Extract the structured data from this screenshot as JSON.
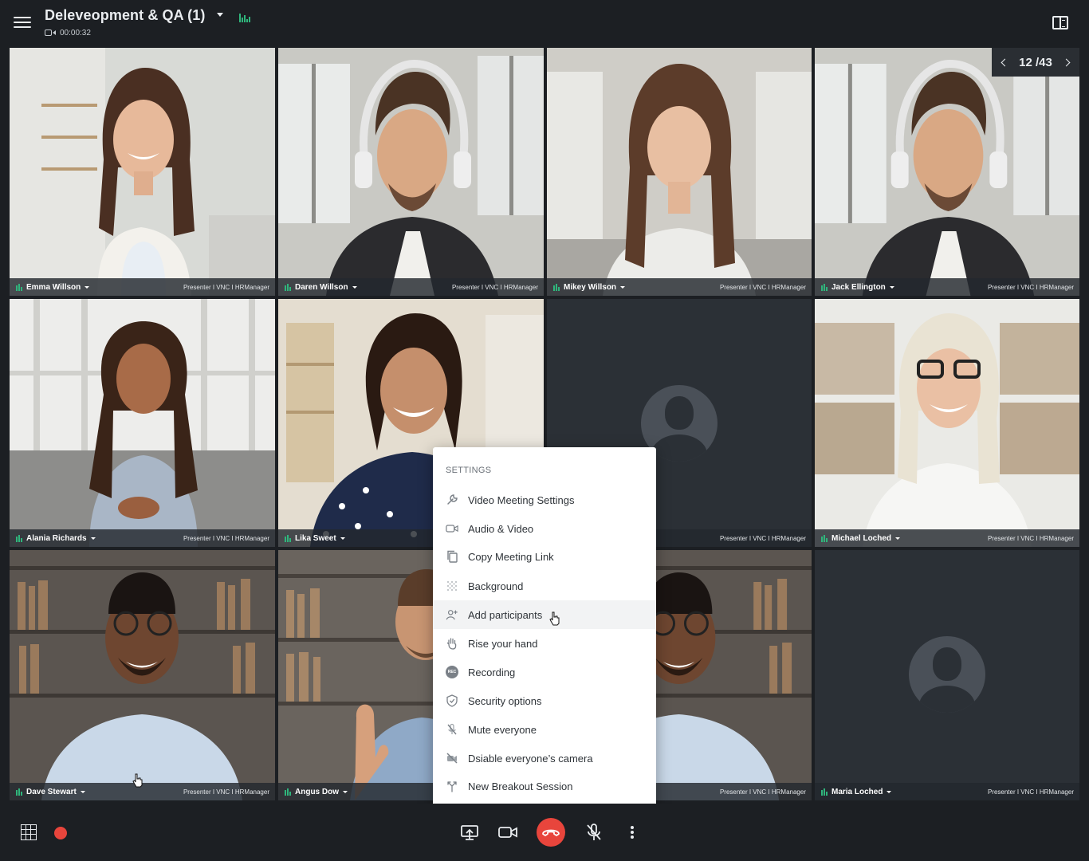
{
  "header": {
    "title": "Deleveopment & QA (1)",
    "timer": "00:00:32",
    "icons": {
      "menu": "hamburger-icon",
      "caret": "chevron-down-icon",
      "audio": "audio-level-icon",
      "camera": "video-camera-icon",
      "sidebar": "sidebar-toggle-icon"
    }
  },
  "pager": {
    "current": "12",
    "separator": " /",
    "total": "43"
  },
  "tiles": [
    {
      "name": "Emma Willson",
      "role": "Presenter I VNC I HRManager"
    },
    {
      "name": "Daren Willson",
      "role": "Presenter I VNC I HRManager"
    },
    {
      "name": "Mikey Willson",
      "role": "Presenter I VNC I HRManager"
    },
    {
      "name": "Jack Ellington",
      "role": "Presenter I VNC I HRManager"
    },
    {
      "name": "Alania Richards",
      "role": "Presenter I VNC I HRManager"
    },
    {
      "name": "Lika Sweet",
      "role": ""
    },
    {
      "name": "",
      "role": "Presenter I VNC I HRManager"
    },
    {
      "name": "Michael Loched",
      "role": "Presenter I VNC I HRManager"
    },
    {
      "name": "Dave Stewart",
      "role": "Presenter I VNC I HRManager"
    },
    {
      "name": "Angus Dow",
      "role": ""
    },
    {
      "name": "",
      "role": "Presenter I VNC I HRManager"
    },
    {
      "name": "Maria Loched",
      "role": "Presenter I VNC I HRManager"
    }
  ],
  "settings_menu": {
    "heading": "SETTINGS",
    "items": [
      {
        "label": "Video Meeting Settings",
        "icon": "wrench-icon"
      },
      {
        "label": "Audio & Video",
        "icon": "video-camera-icon"
      },
      {
        "label": "Copy Meeting Link",
        "icon": "copy-icon"
      },
      {
        "label": "Background",
        "icon": "background-grid-icon"
      },
      {
        "label": "Add participants",
        "icon": "add-user-icon"
      },
      {
        "label": "Rise your hand",
        "icon": "hand-icon"
      },
      {
        "label": "Recording",
        "icon": "rec-icon",
        "icon_text": "REC"
      },
      {
        "label": "Security options",
        "icon": "shield-icon"
      },
      {
        "label": "Mute everyone",
        "icon": "mic-off-icon"
      },
      {
        "label": "Dsiable everyone’s camera",
        "icon": "camera-off-icon"
      },
      {
        "label": "New Breakout Session",
        "icon": "breakout-icon"
      }
    ]
  },
  "toolbar": {
    "icons": [
      "grid-view-icon",
      "recording-dot-icon",
      "screen-share-icon",
      "video-camera-icon",
      "hang-up-icon",
      "mic-off-icon",
      "more-vertical-icon"
    ]
  },
  "colors": {
    "background": "#1c1f23",
    "accent_green": "#1fa868",
    "hangup_red": "#e8453c",
    "tile_empty": "#2b3036"
  }
}
